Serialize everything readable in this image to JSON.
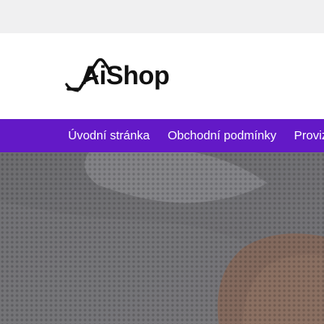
{
  "brand": {
    "logo_text": "AiShop"
  },
  "nav": {
    "items": [
      {
        "label": "Úvodní stránka"
      },
      {
        "label": "Obchodní podmínky"
      },
      {
        "label": "Provize"
      }
    ]
  },
  "colors": {
    "topbar": "#f0f0f1",
    "nav_background": "#6319c7",
    "nav_text": "#ffffff",
    "hero_overlay": "#6f6f72"
  }
}
